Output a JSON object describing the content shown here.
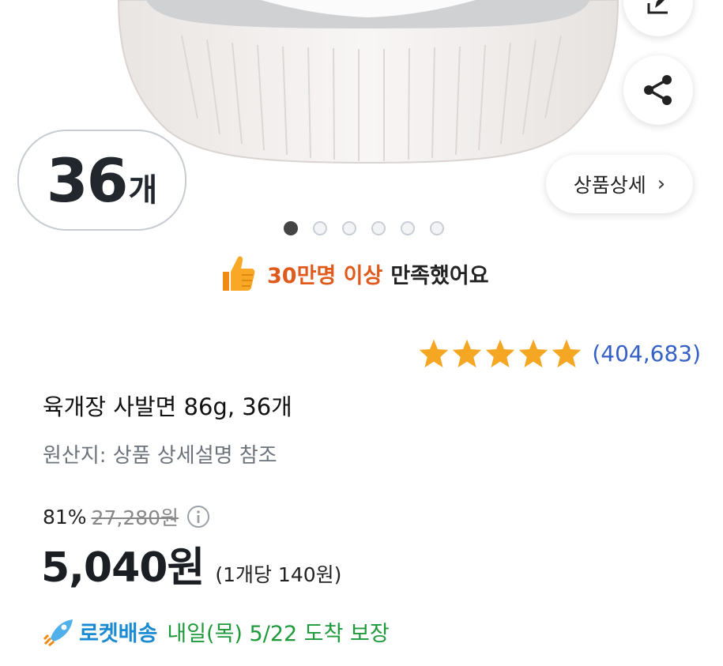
{
  "hero": {
    "count_number": "36",
    "count_unit": "개",
    "detail_button_label": "상품상세",
    "carousel_total": 6,
    "carousel_active": 1
  },
  "satisfaction": {
    "highlight": "30만명 이상",
    "text": "만족했어요"
  },
  "rating": {
    "stars": 5,
    "review_count": "(404,683)"
  },
  "product": {
    "title": "육개장 사발면 86g, 36개",
    "origin": "원산지: 상품 상세설명 참조"
  },
  "price": {
    "discount_percent": "81%",
    "original_price": "27,280원",
    "sale_price": "5,040원",
    "unit_price": "(1개당 140원)"
  },
  "delivery": {
    "brand": "로켓배송",
    "date_text": "내일(목) 5/22 도착 보장"
  },
  "colors": {
    "accent_orange": "#e05a1c",
    "star_yellow": "#f5a623",
    "link_blue": "#3560c6",
    "rocket_blue": "#1a8ad1",
    "delivery_green": "#1e9a3c"
  },
  "icons": [
    "edit-icon",
    "share-icon",
    "chevron-right-icon",
    "thumbs-up-icon",
    "star-icon",
    "info-icon",
    "rocket-icon"
  ]
}
